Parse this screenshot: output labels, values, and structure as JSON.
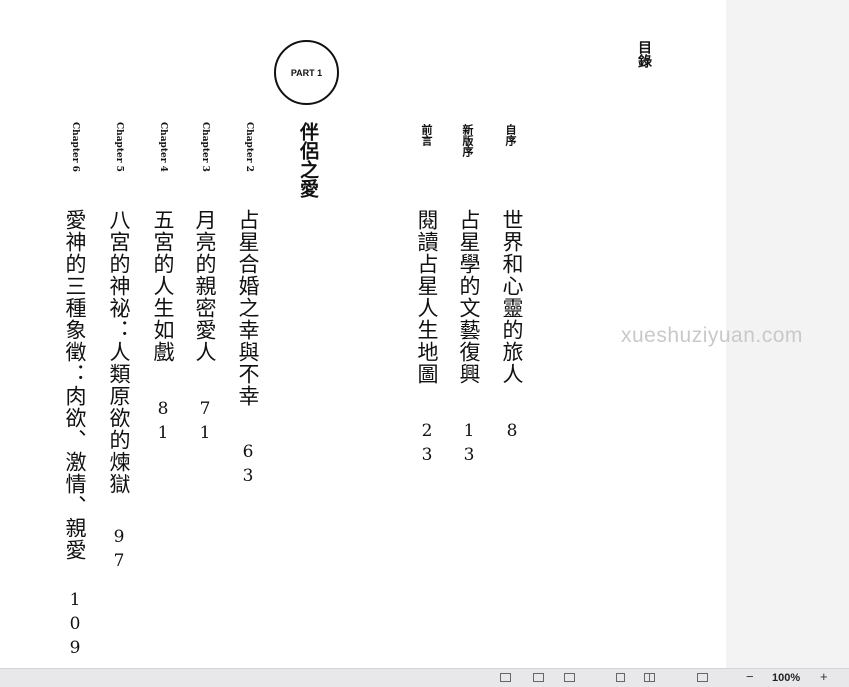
{
  "toc_title": "目錄",
  "front_matter": [
    {
      "label": "自序",
      "title": "世界和心靈的旅人",
      "page": "8"
    },
    {
      "label": "新版序",
      "title": "占星學的文藝復興",
      "page": "13"
    },
    {
      "label": "前言",
      "title": "閱讀占星人生地圖",
      "page": "23"
    }
  ],
  "part": {
    "label": "PART 1",
    "title": "伴侶之愛"
  },
  "chapters": [
    {
      "label": "Chapter 2",
      "title": "占星合婚之幸與不幸",
      "page": "63"
    },
    {
      "label": "Chapter 3",
      "title": "月亮的親密愛人",
      "page": "71"
    },
    {
      "label": "Chapter 4",
      "title": "五宮的人生如戲",
      "page": "81"
    },
    {
      "label": "Chapter 5",
      "title": "八宮的神祕：人類原欲的煉獄",
      "page": "97"
    },
    {
      "label": "Chapter 6",
      "title": "愛神的三種象徵：肉欲、激情、親愛",
      "page": "109"
    }
  ],
  "watermark": "xueshuziyuan.com",
  "statusbar": {
    "zoom_minus": "−",
    "zoom_level": "100%",
    "zoom_plus": "+",
    "icons": [
      "fit-page-icon",
      "fit-width-icon",
      "actual-size-icon",
      "single-page-icon",
      "two-page-icon",
      "continuous-icon"
    ]
  }
}
